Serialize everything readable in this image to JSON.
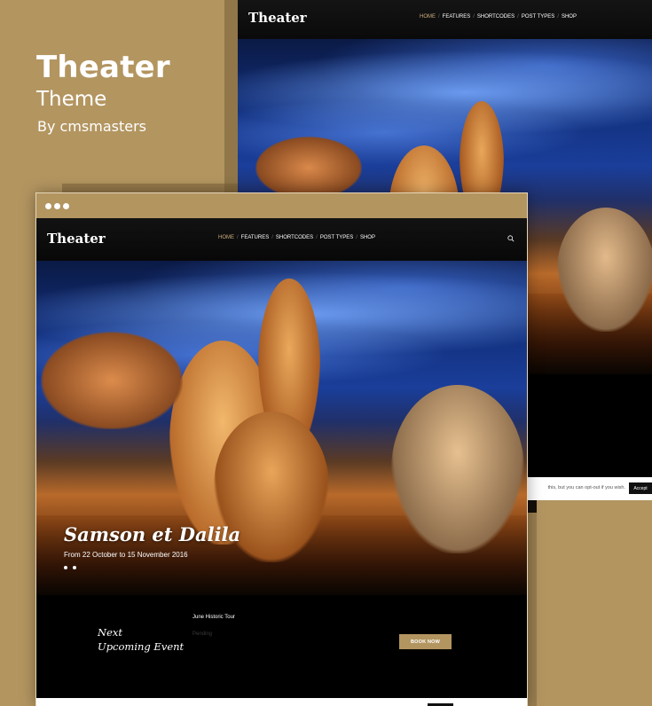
{
  "promo": {
    "title": "Theater",
    "subtitle": "Theme",
    "byline": "By cmsmasters"
  },
  "site": {
    "logo": "Theater",
    "nav": [
      {
        "label": "HOME",
        "active": true
      },
      {
        "label": "FEATURES",
        "active": false
      },
      {
        "label": "SHORTCODES",
        "active": false
      },
      {
        "label": "POST TYPES",
        "active": false
      },
      {
        "label": "SHOP",
        "active": false
      }
    ],
    "nav_separator": "/",
    "search_icon": "search-icon"
  },
  "slider": {
    "title": "Samson et Dalila",
    "dates": "From 22 October to 15 November 2016",
    "dots": 2
  },
  "upcoming": {
    "heading_line1": "Next",
    "heading_line2": "Upcoming Event",
    "event_name": "June Historic Tour",
    "event_status": "Pending",
    "cta": "BOOK NOW"
  },
  "cookie": {
    "text": "this, but you can opt-out if you wish.",
    "accept": "Accept"
  },
  "colors": {
    "accent": "#b39560",
    "nav_active": "#cdb07e",
    "dark": "#000000"
  }
}
